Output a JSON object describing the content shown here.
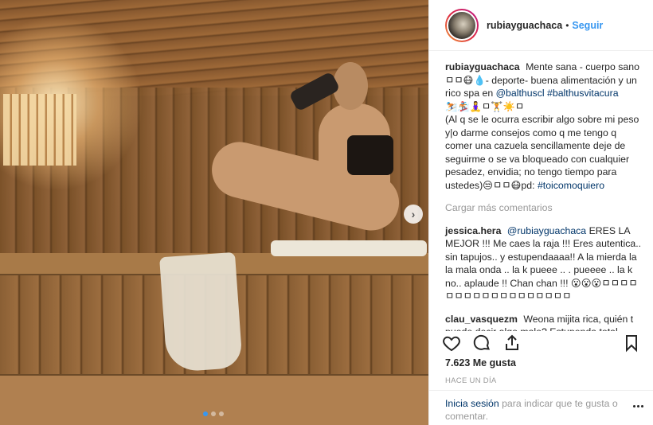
{
  "post": {
    "username": "rubiayguachaca",
    "follow_label": "Seguir",
    "bullet": "•"
  },
  "caption": {
    "username": "rubiayguachaca",
    "text1": "Mente sana - cuerpo sano ㅁㅁ😷💧- deporte- buena alimentación y un rico spa en",
    "mention1": "@balthuscl",
    "hashtag1": "#balthusvitacura",
    "text2": "⛷️🏂🧘‍♀️ㅁ🏋️☀️ㅁ",
    "text3": "(Al q se le ocurra escribir algo sobre mi peso y|o darme consejos como q me tengo q comer una cazuela sencillamente deje de seguirme o se va bloqueado con cualquier pesadez, envidia; no tengo tiempo para ustedes)😒ㅁㅁ😷pd:",
    "hashtag2": "#toicomoquiero"
  },
  "load_more": "Cargar más comentarios",
  "comments": [
    {
      "user": "jessica.hera",
      "mention": "@rubiayguachaca",
      "text": "ERES LA MEJOR !!! Me caes la raja !!! Eres autentica.. sin tapujos.. y estupendaaaa!! A la mierda la la mala onda .. la k pueee .. . pueeee .. la k no.. aplaude !! Chan chan !!! 😮😮😮ㅁㅁㅁㅁㅁㅁㅁㅁㅁㅁㅁㅁㅁㅁㅁㅁㅁㅁ"
    },
    {
      "user": "clau_vasquezm",
      "text": "Weona mijita rica, quién t puede decir algo malo? Estupenda total"
    }
  ],
  "likes": "7.623 Me gusta",
  "time_ago": "HACE UN DÍA",
  "login": {
    "link": "Inicia sesión",
    "text": "para indicar que te gusta o comentar."
  },
  "icons": {
    "like": "heart-icon",
    "comment": "comment-icon",
    "share": "share-icon",
    "save": "bookmark-icon",
    "next": "chevron-right-icon",
    "more": "more-options-icon"
  },
  "carousel": {
    "slide_count": 3,
    "active_index": 0
  }
}
